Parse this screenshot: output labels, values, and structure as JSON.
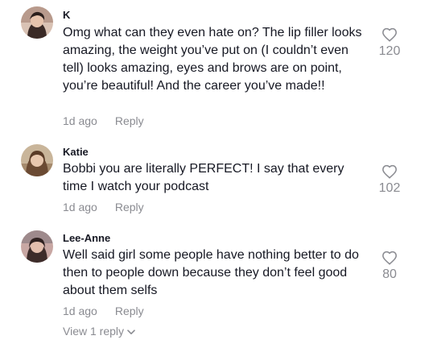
{
  "comments": [
    {
      "username": "K",
      "text": "Omg what can they even hate on? The lip filler looks amazing, the weight you’ve put on (I couldn’t even tell) looks amazing, eyes and brows are on point, you’re beautiful! And the career you’ve made!!",
      "time": "1d ago",
      "reply_label": "Reply",
      "likes": "120"
    },
    {
      "username": "Katie",
      "text": "Bobbi you are literally PERFECT! I say that every time I watch your podcast",
      "time": "1d ago",
      "reply_label": "Reply",
      "likes": "102"
    },
    {
      "username": "Lee-Anne",
      "text": "Well said girl some people have nothing better to do then to people down because they don’t feel good about them selfs",
      "time": "1d ago",
      "reply_label": "Reply",
      "likes": "80"
    }
  ],
  "view_replies": {
    "label": "View 1 reply"
  },
  "icons": {
    "like": "heart-outline-icon",
    "expand": "chevron-down-icon"
  },
  "colors": {
    "primary_text": "#161823",
    "secondary_text": "#8a8b91"
  }
}
